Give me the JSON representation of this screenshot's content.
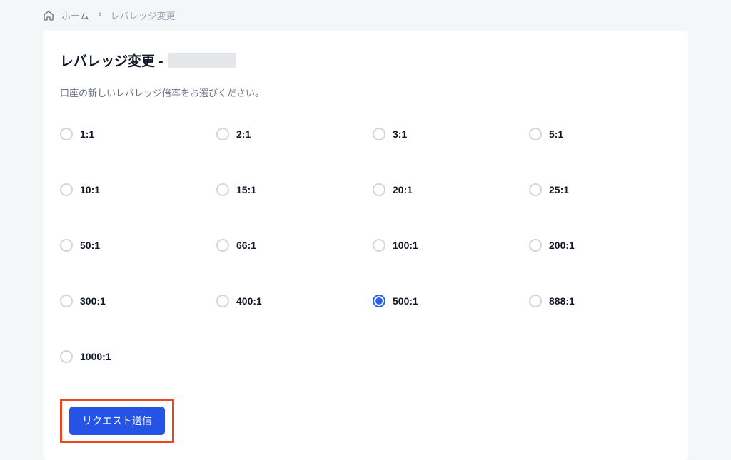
{
  "breadcrumb": {
    "home_label": "ホーム",
    "current_label": "レバレッジ変更"
  },
  "page": {
    "title": "レバレッジ変更 -",
    "instruction": "口座の新しいレバレッジ倍率をお選びください。"
  },
  "leverage_options": [
    {
      "label": "1:1",
      "selected": false
    },
    {
      "label": "2:1",
      "selected": false
    },
    {
      "label": "5:1",
      "selected": false,
      "col": 4
    },
    {
      "label": "3:1",
      "selected": false,
      "col": 3
    },
    {
      "label": "10:1",
      "selected": false
    },
    {
      "label": "15:1",
      "selected": false
    },
    {
      "label": "20:1",
      "selected": false
    },
    {
      "label": "25:1",
      "selected": false
    },
    {
      "label": "50:1",
      "selected": false
    },
    {
      "label": "66:1",
      "selected": false
    },
    {
      "label": "100:1",
      "selected": false
    },
    {
      "label": "200:1",
      "selected": false
    },
    {
      "label": "300:1",
      "selected": false
    },
    {
      "label": "400:1",
      "selected": false
    },
    {
      "label": "500:1",
      "selected": true
    },
    {
      "label": "888:1",
      "selected": false
    },
    {
      "label": "1000:1",
      "selected": false
    }
  ],
  "grid_order": [
    "1:1",
    "2:1",
    "3:1",
    "5:1",
    "10:1",
    "15:1",
    "20:1",
    "25:1",
    "50:1",
    "66:1",
    "100:1",
    "200:1",
    "300:1",
    "400:1",
    "500:1",
    "888:1",
    "1000:1"
  ],
  "selected_value": "500:1",
  "actions": {
    "submit_label": "リクエスト送信"
  }
}
